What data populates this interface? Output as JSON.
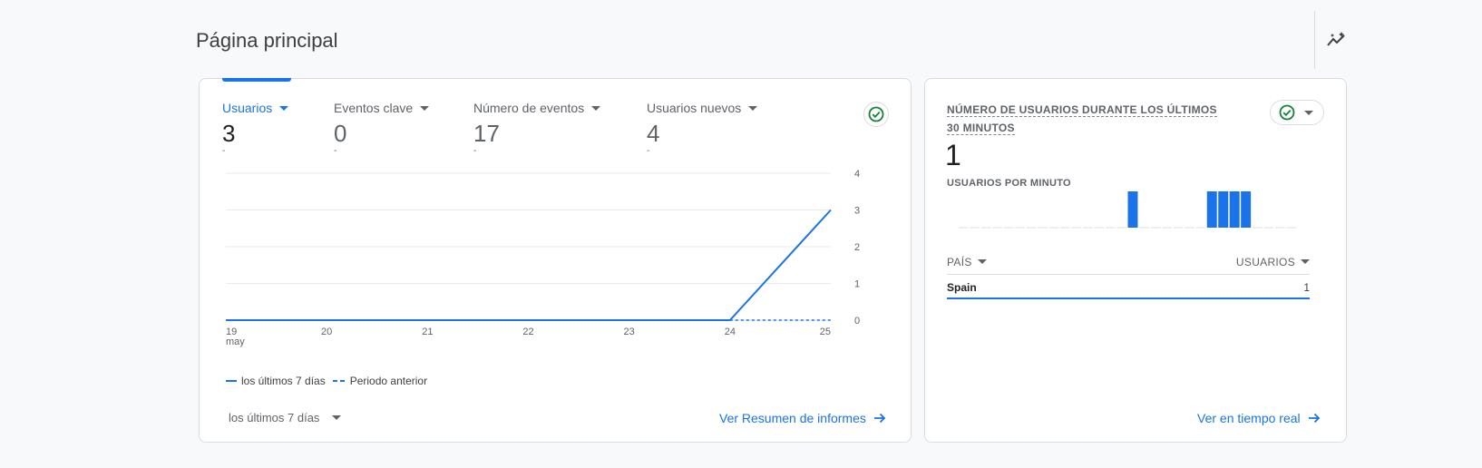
{
  "page": {
    "title": "Página principal"
  },
  "main_card": {
    "metrics": [
      {
        "label": "Usuarios",
        "value": "3",
        "delta": "-",
        "active": true
      },
      {
        "label": "Eventos clave",
        "value": "0",
        "delta": "-",
        "active": false
      },
      {
        "label": "Número de eventos",
        "value": "17",
        "delta": "-",
        "active": false
      },
      {
        "label": "Usuarios nuevos",
        "value": "4",
        "delta": "-",
        "active": false
      }
    ],
    "legend": {
      "current": "los últimos 7 días",
      "previous": "Periodo anterior"
    },
    "date_range": "los últimos 7 días",
    "link": "Ver Resumen de informes"
  },
  "chart_data": {
    "type": "line",
    "x": [
      "19",
      "20",
      "21",
      "22",
      "23",
      "24",
      "25"
    ],
    "x_sublabel_first": "may",
    "ylim": [
      0,
      4
    ],
    "yticks": [
      "0",
      "1",
      "2",
      "3",
      "4"
    ],
    "series": [
      {
        "name": "los últimos 7 días",
        "values": [
          0,
          0,
          0,
          0,
          0,
          0,
          3
        ],
        "style": "solid",
        "color": "#1a73e8"
      },
      {
        "name": "Periodo anterior",
        "values": [
          null,
          null,
          null,
          null,
          null,
          0,
          0
        ],
        "style": "dashed",
        "color": "#1a73e8"
      }
    ],
    "grid": true
  },
  "realtime_card": {
    "title_line1": "NÚMERO DE USUARIOS DURANTE LOS ÚLTIMOS",
    "title_line2": "30 MINUTOS",
    "value": "1",
    "subtitle": "USUARIOS POR MINUTO",
    "per_minute": [
      0,
      0,
      0,
      0,
      0,
      0,
      0,
      0,
      0,
      0,
      0,
      0,
      0,
      0,
      0,
      1,
      0,
      0,
      0,
      0,
      0,
      0,
      1,
      1,
      1,
      1,
      0,
      0,
      0,
      0
    ],
    "table": {
      "col1": "PAÍS",
      "col2": "USUARIOS",
      "rows": [
        {
          "country": "Spain",
          "users": "1"
        }
      ]
    },
    "link": "Ver en tiempo real"
  },
  "colors": {
    "accent": "#1a73e8",
    "success": "#188038"
  }
}
